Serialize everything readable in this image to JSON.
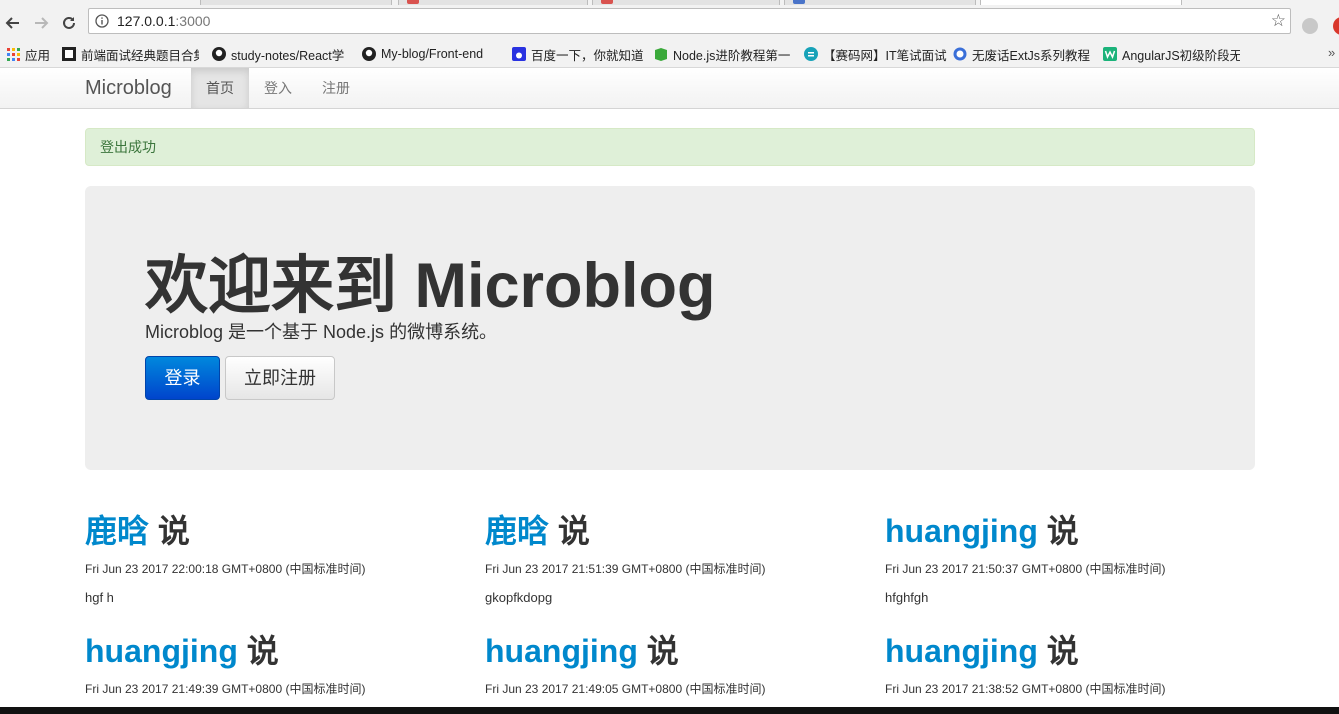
{
  "browser": {
    "url_host": "127.0.0.1",
    "url_port": ":3000",
    "bookmarks": [
      {
        "label": "应用",
        "icon": "apps-grid-icon"
      },
      {
        "label": "前端面试经典题目合集",
        "icon": "bookmark-page-icon"
      },
      {
        "label": "study-notes/React学",
        "icon": "github-icon"
      },
      {
        "label": "My-blog/Front-end",
        "icon": "github-icon"
      },
      {
        "label": "百度一下，你就知道",
        "icon": "baidu-paw-icon"
      },
      {
        "label": "Node.js进阶教程第一",
        "icon": "bookmark-green-icon"
      },
      {
        "label": "【赛码网】IT笔试面试",
        "icon": "saima-icon"
      },
      {
        "label": "无废话ExtJs系列教程",
        "icon": "extjs-icon"
      },
      {
        "label": "AngularJS初级阶段无",
        "icon": "w-icon"
      }
    ]
  },
  "navbar": {
    "brand": "Microblog",
    "items": [
      {
        "label": "首页",
        "active": true
      },
      {
        "label": "登入",
        "active": false
      },
      {
        "label": "注册",
        "active": false
      }
    ]
  },
  "alert": {
    "text": "登出成功"
  },
  "hero": {
    "title": "欢迎来到 Microblog",
    "subtitle": "Microblog 是一个基于 Node.js 的微博系统。",
    "login_button": "登录",
    "register_button": "立即注册"
  },
  "posts": [
    {
      "user": "鹿晗",
      "says": "说",
      "time": "Fri Jun 23 2017 22:00:18 GMT+0800 (中国标准时间)",
      "content": "hgf h"
    },
    {
      "user": "鹿晗",
      "says": "说",
      "time": "Fri Jun 23 2017 21:51:39 GMT+0800 (中国标准时间)",
      "content": "gkopfkdopg"
    },
    {
      "user": "huangjing",
      "says": "说",
      "time": "Fri Jun 23 2017 21:50:37 GMT+0800 (中国标准时间)",
      "content": "hfghfgh"
    },
    {
      "user": "huangjing",
      "says": "说",
      "time": "Fri Jun 23 2017 21:49:39 GMT+0800 (中国标准时间)",
      "content": ""
    },
    {
      "user": "huangjing",
      "says": "说",
      "time": "Fri Jun 23 2017 21:49:05 GMT+0800 (中国标准时间)",
      "content": ""
    },
    {
      "user": "huangjing",
      "says": "说",
      "time": "Fri Jun 23 2017 21:38:52 GMT+0800 (中国标准时间)",
      "content": ""
    }
  ],
  "colors": {
    "link": "#0088cc",
    "alert_bg": "#dff0d8",
    "alert_text": "#3c763d",
    "primary": "#0066cc"
  }
}
